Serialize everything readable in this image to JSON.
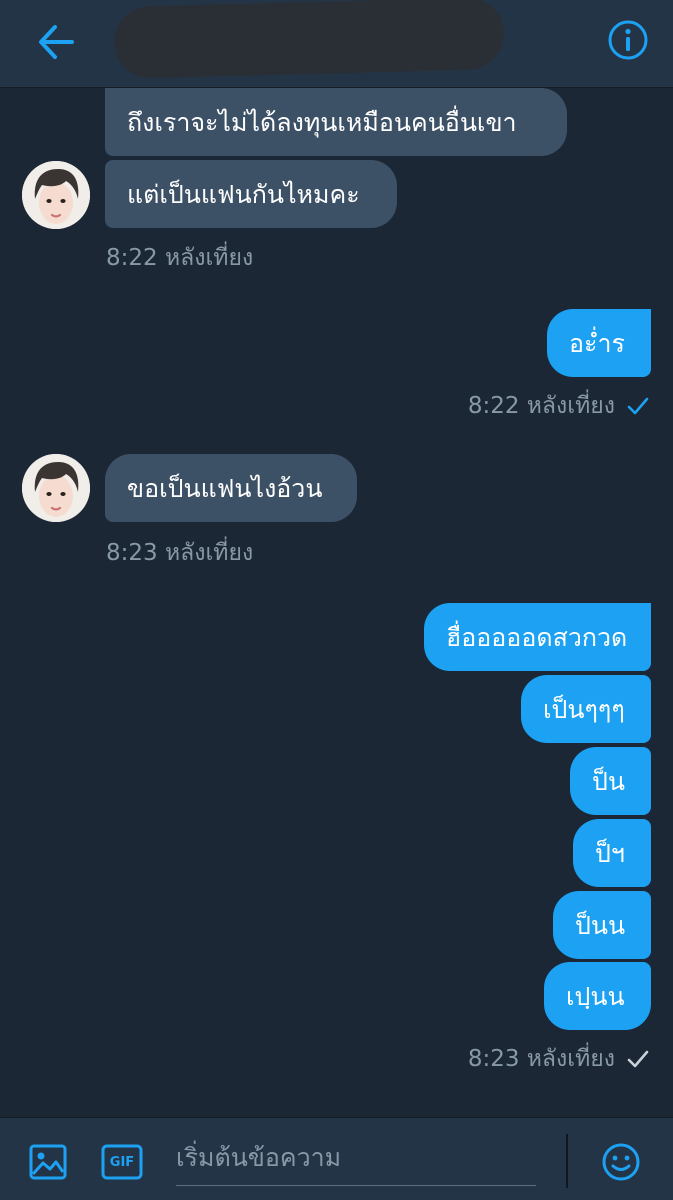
{
  "header": {
    "back_icon": "arrow-left-icon",
    "title_redacted": "",
    "info_icon": "info-circle-icon",
    "accent": "#1da1f2"
  },
  "messages": {
    "m1": "ถึงเราจะไม่ได้ลงทุนเหมือนคนอื่นเขา",
    "m2": "แต่เป็นแฟนกันไหมคะ",
    "t1": "8:22 หลังเที่ยง",
    "m3": "อะ่ำร",
    "t2": "8:22 หลังเที่ยง",
    "m4": "ขอเป็นแฟนไงอ้วน",
    "t3": "8:23 หลังเที่ยง",
    "m5": "ฮื่อออออดสวกวด",
    "m6": "เป็นๆๆๆ",
    "m7": "ป็น",
    "m8": "ป็ฯ",
    "m9": "ป็นน",
    "m10": "เปฺนน",
    "t4": "8:23 หลังเที่ยง"
  },
  "compose": {
    "placeholder": "เริ่มต้นข้อความ",
    "gif_label": "GIF",
    "image_icon": "image-icon",
    "emoji_icon": "emoji-icon"
  },
  "colors": {
    "background": "#1b2735",
    "header": "#243447",
    "incoming_bubble": "#3d5166",
    "outgoing_bubble": "#1da1f2",
    "meta_text": "#8899a6"
  }
}
